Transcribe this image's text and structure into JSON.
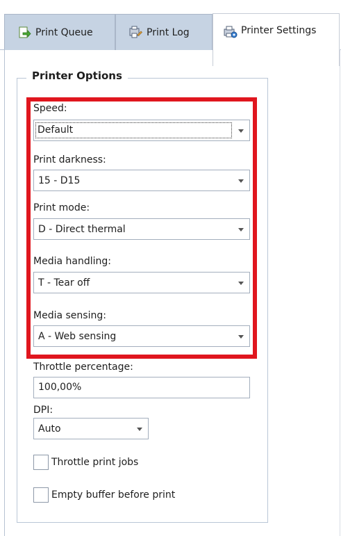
{
  "tabs": [
    {
      "label": "Print Queue",
      "icon": "print-queue-icon"
    },
    {
      "label": "Print Log",
      "icon": "print-log-icon"
    },
    {
      "label": "Printer Settings",
      "icon": "printer-settings-icon",
      "active": true
    }
  ],
  "group": {
    "title": "Printer Options"
  },
  "fields": {
    "speed": {
      "label": "Speed:",
      "value": "Default"
    },
    "darkness": {
      "label": "Print darkness:",
      "value": "15 - D15"
    },
    "mode": {
      "label": "Print mode:",
      "value": "D - Direct thermal"
    },
    "media_handling": {
      "label": "Media handling:",
      "value": "T - Tear off"
    },
    "media_sensing": {
      "label": "Media sensing:",
      "value": "A - Web sensing"
    },
    "throttle": {
      "label": "Throttle percentage:",
      "value": "100,00%"
    },
    "dpi": {
      "label": "DPI:",
      "value": "Auto"
    }
  },
  "checkboxes": {
    "throttle_jobs": {
      "label": "Throttle print jobs",
      "checked": false
    },
    "empty_buffer": {
      "label": "Empty buffer before print",
      "checked": false
    }
  },
  "colors": {
    "highlight": "#e0161e",
    "tab_inactive": "#c6d3e3"
  }
}
